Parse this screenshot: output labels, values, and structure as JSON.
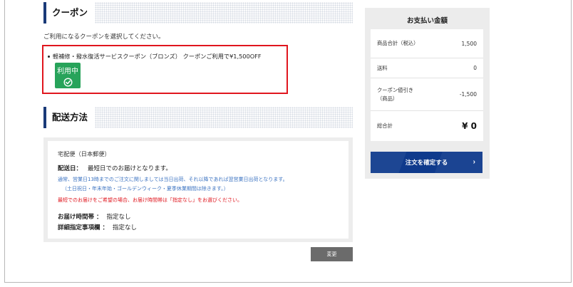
{
  "coupon": {
    "heading": "クーポン",
    "intro": "ご利用になるクーポンを選択してください。",
    "item_text": "軽補修・撥水復活サービスクーポン（ブロンズ） クーポンご利用で¥1,500OFF",
    "status_badge": "利用中"
  },
  "delivery": {
    "heading": "配送方法",
    "method": "宅配便（日本郵便）",
    "date_label": "配送日：",
    "date_value": "最短日でのお届けとなります。",
    "note_blue_1": "通常、営業日13時までのご注文に関しましては当日出荷、それ以降であれば翌営業日出荷となります。",
    "note_blue_2": "（土日祝日・年末年始・ゴールデンウィーク・夏季休業期間は除きます。）",
    "note_red": "最短でのお届けをご希望の場合、お届け時間帯は「指定なし」をお選びください。",
    "time_label": "お届け時間帯 ：",
    "time_value": "指定なし",
    "detail_label": "詳細指定事項欄 ：",
    "detail_value": "指定なし",
    "change_button": "変更"
  },
  "summary": {
    "title": "お支払い金額",
    "rows": [
      {
        "label": "商品合計（税込）",
        "value": "1,500"
      },
      {
        "label": "送料",
        "value": "0"
      },
      {
        "label": "クーポン値引き（商品）",
        "value": "-1,500"
      },
      {
        "label": "総合計",
        "value": "¥ 0"
      }
    ],
    "confirm_button": "注文を確定する",
    "confirm_arrow": "›"
  },
  "icons": {
    "check": "check-circle-icon",
    "arrow": "chevron-right-icon"
  },
  "colors": {
    "accent_navy": "#0f3a8c",
    "badge_green": "#27a35a",
    "highlight_red": "#e0161e",
    "note_blue": "#3d74c2"
  }
}
